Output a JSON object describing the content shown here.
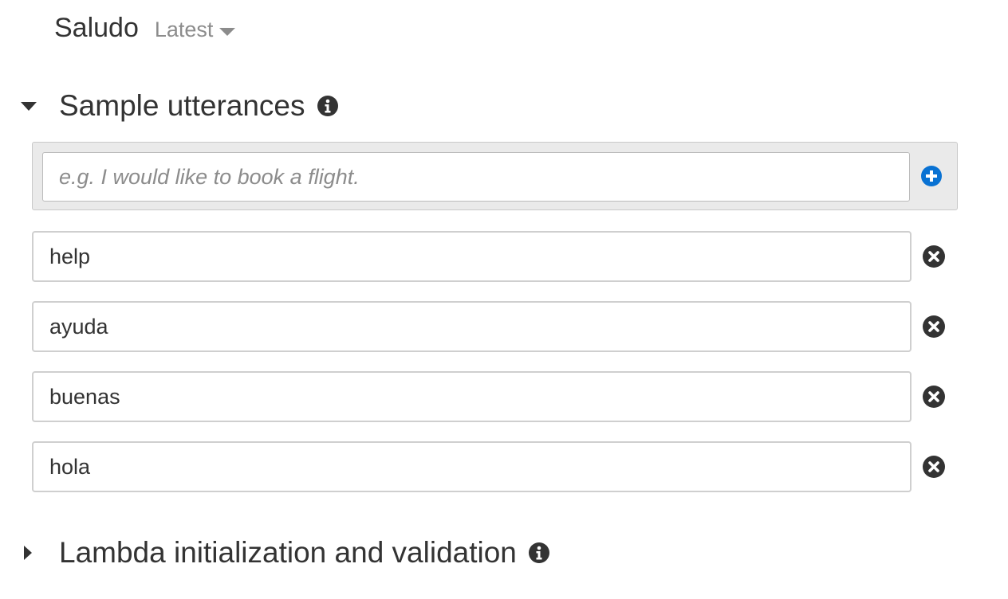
{
  "intent": {
    "name": "Saludo",
    "version": "Latest"
  },
  "sample_utterances": {
    "title": "Sample utterances",
    "new_placeholder": "e.g. I would like to book a flight.",
    "items": [
      "help",
      "ayuda",
      "buenas",
      "hola"
    ]
  },
  "lambda_section": {
    "title": "Lambda initialization and validation"
  },
  "icons": {
    "info": "info-circle-icon",
    "add": "plus-circle-icon",
    "remove": "x-circle-icon",
    "expanded": "caret-down-icon",
    "collapsed": "caret-right-icon"
  },
  "colors": {
    "accent": "#0972d3",
    "text": "#333333",
    "muted": "#8c8c8c",
    "panel": "#eaeaea"
  }
}
